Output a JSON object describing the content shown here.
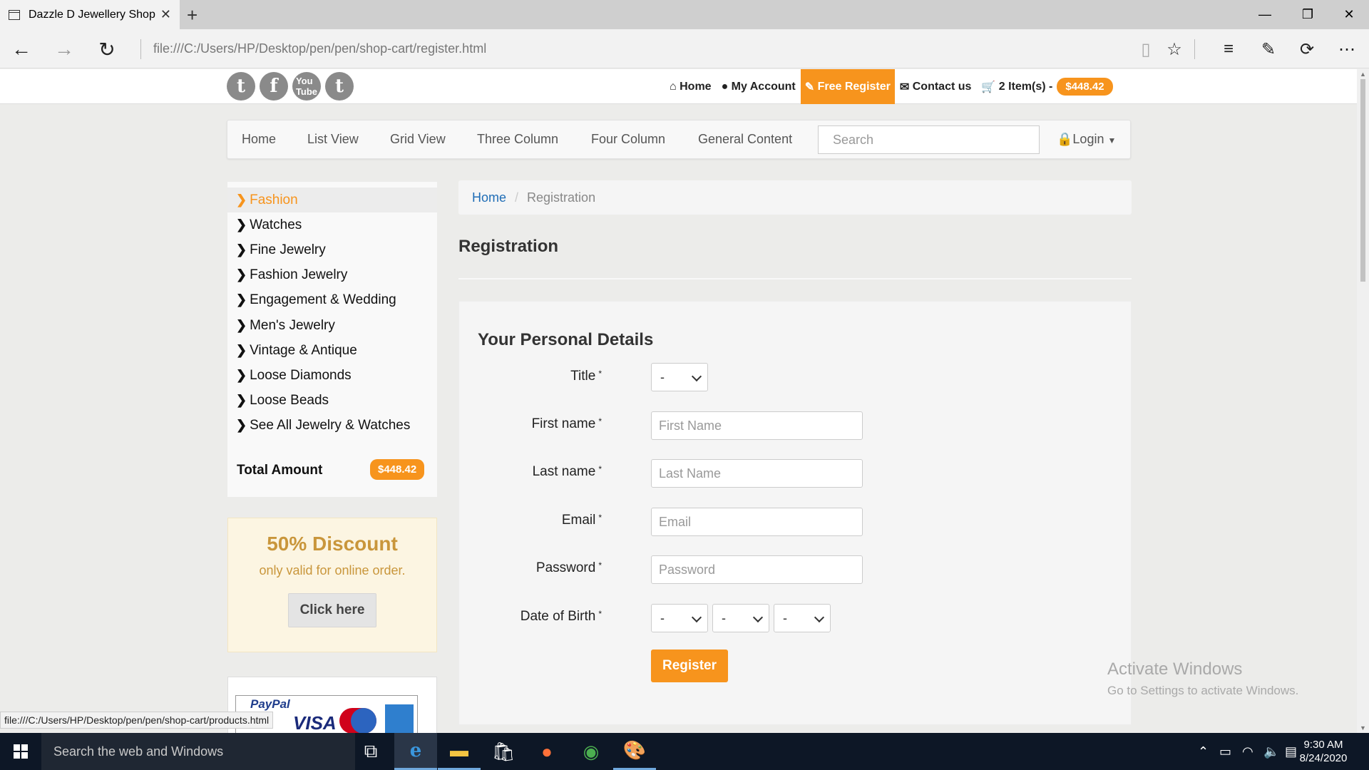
{
  "browser": {
    "tab_title": "Dazzle D Jewellery Shop",
    "url": "file:///C:/Users/HP/Desktop/pen/pen/shop-cart/register.html",
    "status_url": "file:///C:/Users/HP/Desktop/pen/pen/shop-cart/products.html"
  },
  "topbar": {
    "home": "Home",
    "my_account": "My Account",
    "free_register": "Free Register",
    "contact_us": "Contact us",
    "cart_items": "2 Item(s) -",
    "cart_total": "$448.42"
  },
  "nav": {
    "items": [
      "Home",
      "List View",
      "Grid View",
      "Three Column",
      "Four Column",
      "General Content"
    ],
    "search_placeholder": "Search",
    "login": "Login"
  },
  "sidebar": {
    "categories": [
      "Fashion",
      "Watches",
      "Fine Jewelry",
      "Fashion Jewelry",
      "Engagement & Wedding",
      "Men's Jewelry",
      "Vintage & Antique",
      "Loose Diamonds",
      "Loose Beads",
      "See All Jewelry & Watches"
    ],
    "active_category": "Fashion",
    "total_label": "Total Amount",
    "total_value": "$448.42"
  },
  "promo": {
    "title": "50% Discount",
    "subtitle": "only valid for online order.",
    "button": "Click here"
  },
  "payment": {
    "paypal": "PayPal",
    "visa": "VISA"
  },
  "breadcrumb": {
    "home": "Home",
    "current": "Registration"
  },
  "main": {
    "title": "Registration",
    "form_heading": "Your Personal Details",
    "fields": {
      "title_label": "Title",
      "title_value": "-",
      "first_name_label": "First name",
      "first_name_placeholder": "First Name",
      "last_name_label": "Last name",
      "last_name_placeholder": "Last Name",
      "email_label": "Email",
      "email_placeholder": "Email",
      "password_label": "Password",
      "password_placeholder": "Password",
      "dob_label": "Date of Birth",
      "dob_day": "-",
      "dob_month": "-",
      "dob_year": "-",
      "required_mark": "*"
    },
    "register_button": "Register"
  },
  "watermark": {
    "line1": "Activate Windows",
    "line2": "Go to Settings to activate Windows."
  },
  "taskbar": {
    "search_placeholder": "Search the web and Windows",
    "time": "9:30 AM",
    "date": "8/24/2020"
  },
  "colors": {
    "accent": "#f7941d",
    "link": "#1f6db6",
    "taskbar": "#0d1726"
  }
}
